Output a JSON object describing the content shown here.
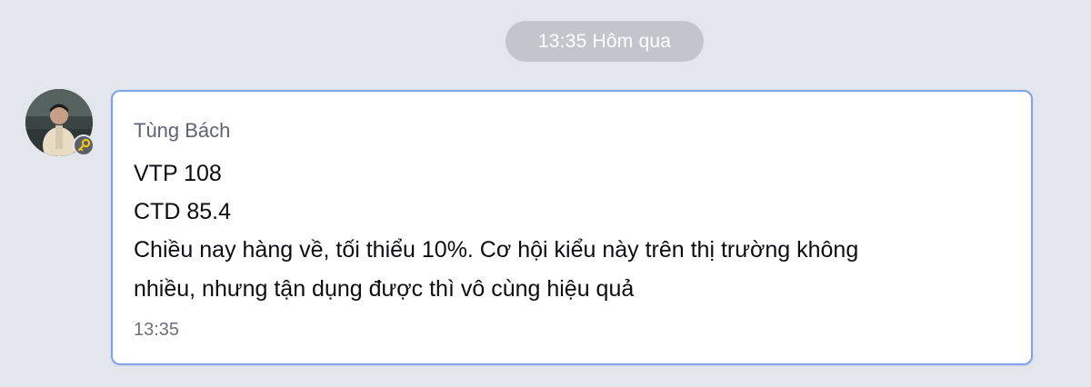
{
  "date_separator": "13:35 Hôm qua",
  "message": {
    "sender": "Tùng Bách",
    "lines": [
      "VTP 108",
      "CTD 85.4",
      "Chiều nay hàng về, tối thiểu 10%. Cơ hội kiểu này trên thị trường không",
      "nhiều, nhưng tận dụng được thì vô cùng hiệu quả"
    ],
    "time": "13:35"
  },
  "colors": {
    "background": "#e4e6ee",
    "bubble_border": "#7fa3e8",
    "key_icon": "#f0c11c"
  },
  "icons": {
    "avatar": "avatar",
    "badge": "key-icon"
  }
}
